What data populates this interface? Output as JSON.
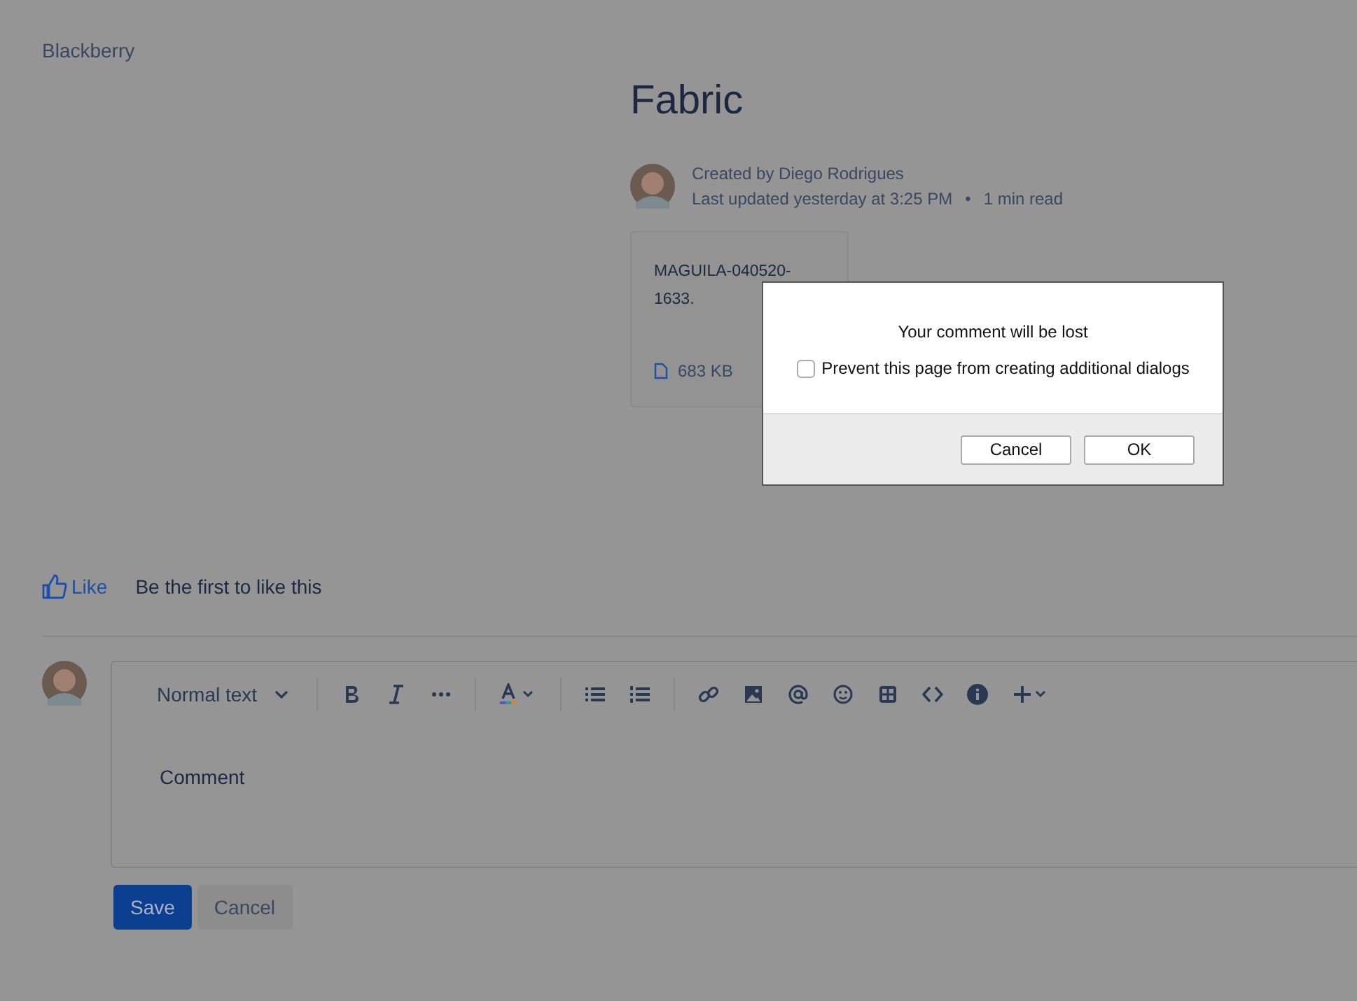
{
  "space": {
    "name": "Blackberry"
  },
  "page": {
    "title": "Fabric",
    "created_by": "Created by Diego Rodrigues",
    "updated": "Last updated yesterday at 3:25 PM",
    "separator": "•",
    "read_time": "1 min read"
  },
  "attachment": {
    "name": "MAGUILA-040520-1633.",
    "size": "683 KB"
  },
  "likes": {
    "like_label": "Like",
    "text": "Be the first to like this"
  },
  "editor": {
    "text_style": "Normal text",
    "placeholder": "Comment",
    "save": "Save",
    "cancel": "Cancel"
  },
  "dialog": {
    "message": "Your comment will be lost",
    "checkbox": {
      "label": "Prevent this page from creating additional dialogs",
      "checked": false
    },
    "buttons": [
      {
        "label": "Cancel"
      },
      {
        "label": "OK"
      }
    ]
  }
}
